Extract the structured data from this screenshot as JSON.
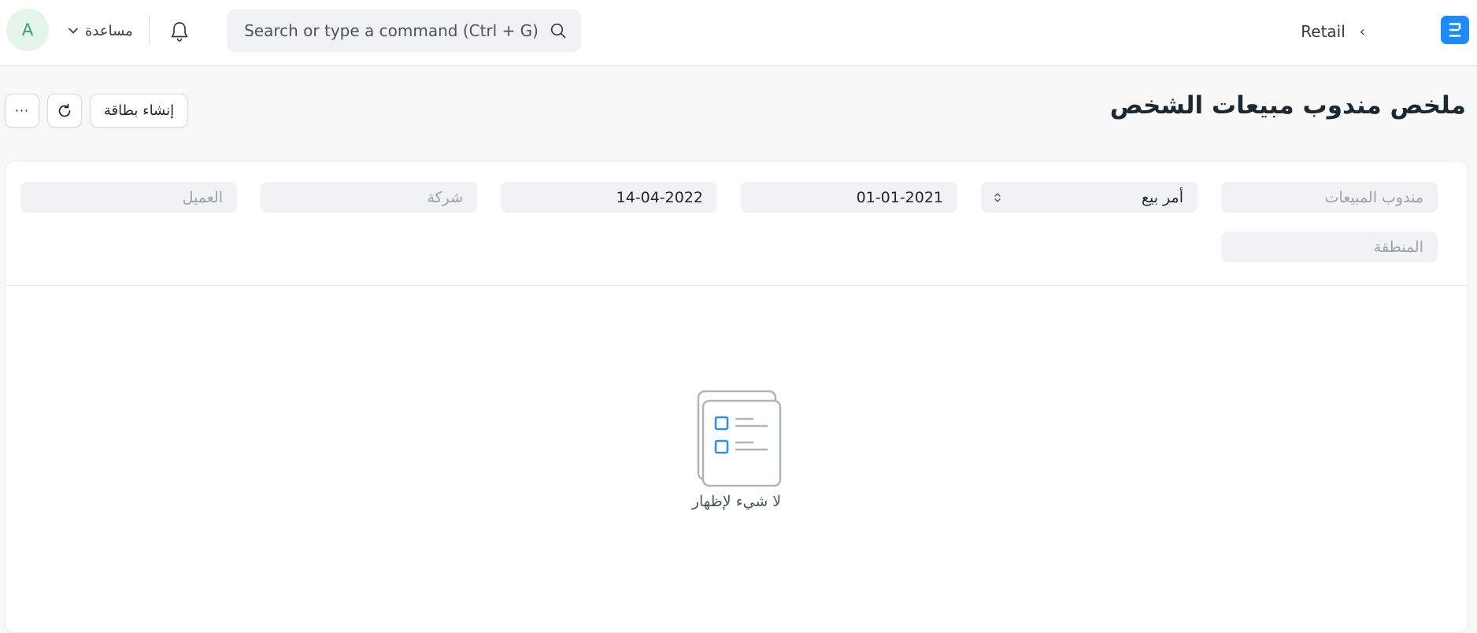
{
  "navbar": {
    "avatar_initial": "A",
    "help_label": "مساعدة",
    "search_placeholder": "Search or type a command (Ctrl + G)",
    "breadcrumb": [
      "Retail"
    ],
    "logo_letter": "E",
    "icons": {
      "avatar": "avatar",
      "help_chevron": "chevron-down-icon",
      "notifications": "bell-icon",
      "search": "search-icon",
      "breadcrumb_separator": "chevron-left-icon",
      "logo": "erpnext-logo"
    },
    "colors": {
      "logo_bg": "#1d8cf8",
      "avatar_bg": "#e4f5e9",
      "avatar_text": "#36a564"
    }
  },
  "page": {
    "title": "ملخص مندوب مبيعات الشخص",
    "create_card_label": "إنشاء بطاقة",
    "more_label": "···",
    "icons": {
      "refresh": "refresh-icon",
      "more": "more-icon"
    }
  },
  "filters": {
    "sales_person": {
      "placeholder": "مندوب المبيعات"
    },
    "doc_type": {
      "value": "أمر بيع"
    },
    "from_date": {
      "value": "01-01-2021"
    },
    "to_date": {
      "value": "14-04-2022"
    },
    "company": {
      "placeholder": "شركة"
    },
    "customer": {
      "placeholder": "العميل"
    },
    "territory": {
      "placeholder": "المنطقة"
    }
  },
  "empty_state": {
    "message": "لا شيء لإظهار",
    "icon": "empty-list-icon",
    "accent_color": "#2490ef"
  }
}
